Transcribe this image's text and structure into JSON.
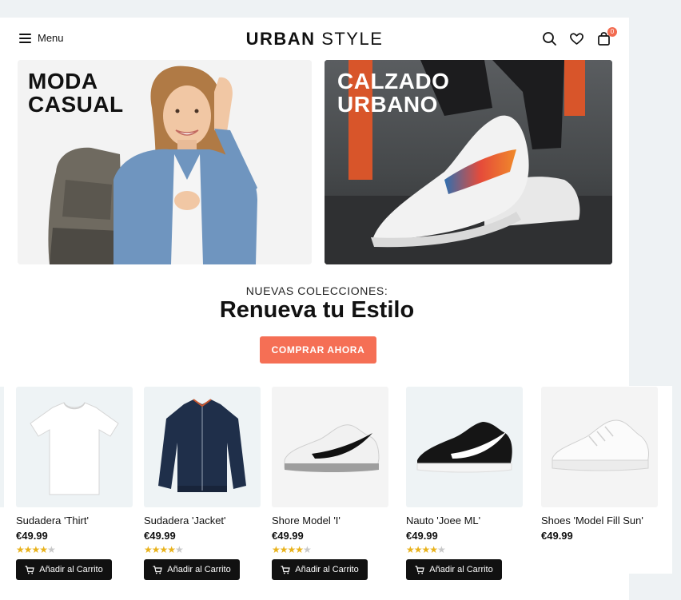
{
  "header": {
    "menu_label": "Menu",
    "logo_bold": "URBAN",
    "logo_light": "STYLE",
    "cart_count": "0"
  },
  "banners": [
    {
      "title": "MODA\nCASUAL"
    },
    {
      "title": "CALZADO\nURBANO"
    }
  ],
  "hero": {
    "kicker": "NUEVAS COLECCIONES:",
    "headline": "Renueva tu Estilo",
    "cta_label": "COMPRAR AHORA"
  },
  "products": [
    {
      "name": "Sudadera 'Thirt'",
      "price": "€49.99",
      "rating": 4.5,
      "add_label": "Añadir al Carrito",
      "image": "tshirt-icon"
    },
    {
      "name": "Sudadera 'Jacket'",
      "price": "€49.99",
      "rating": 4.5,
      "add_label": "Añadir al Carrito",
      "image": "jacket-icon"
    },
    {
      "name": "Shore Model 'I'",
      "price": "€49.99",
      "rating": 4.5,
      "add_label": "Añadir al Carrito",
      "image": "sneaker-grey-icon"
    },
    {
      "name": "Nauto 'Joee ML'",
      "price": "€49.99",
      "rating": 4.5,
      "add_label": "Añadir al Carrito",
      "image": "sneaker-black-icon"
    },
    {
      "name": "Shoes 'Model Fill Sun'",
      "price": "€49.99",
      "rating": null,
      "add_label": "",
      "image": "sneaker-white-icon"
    }
  ],
  "colors": {
    "accent": "#f56f55",
    "badge": "#f26b50",
    "star": "#e9b21b",
    "button_dark": "#111111"
  }
}
